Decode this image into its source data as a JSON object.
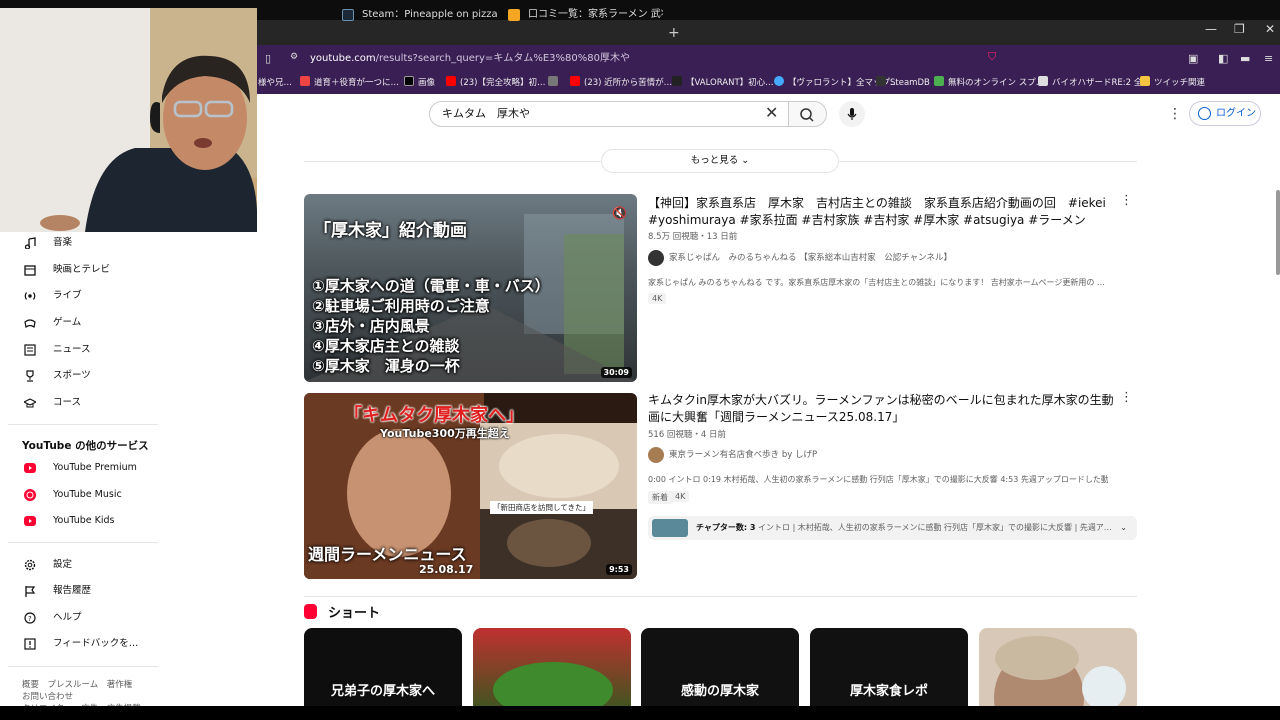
{
  "browser": {
    "tabs": [
      {
        "label": "Steam：Pineapple on pizza",
        "x": 0
      },
      {
        "label": "口コミ一覧：家系ラーメン 武将家 - 秋葉",
        "x": 0
      }
    ],
    "address": {
      "host": "youtube.com",
      "path": "/results?search_query=キムタム%E3%80%80厚木や"
    },
    "bookmarks": [
      "様や兄…",
      "道育＋役育が一つに…",
      "画像",
      "(23)【完全攻略】初…",
      "",
      "(23) 近所から苦情が…",
      "【VALORANT】初心…",
      "【ヴァロラント】全マップ…",
      "SteamDB",
      "無料のオンライン スプ…",
      "バイオハザードRE:2 全…",
      "ツイッチ関連"
    ],
    "win_controls": {
      "min": "—",
      "max": "❐",
      "close": "✕"
    }
  },
  "masthead": {
    "search_value": "キムタム　厚木や",
    "login_label": "ログイン"
  },
  "filters": {
    "more_label": "もっと見る"
  },
  "sidebar": {
    "items": [
      {
        "label": "音楽"
      },
      {
        "label": "映画とテレビ"
      },
      {
        "label": "ライブ"
      },
      {
        "label": "ゲーム"
      },
      {
        "label": "ニュース"
      },
      {
        "label": "スポーツ"
      },
      {
        "label": "コース"
      }
    ],
    "more_services_title": "YouTube の他のサービス",
    "services": [
      {
        "label": "YouTube Premium"
      },
      {
        "label": "YouTube Music"
      },
      {
        "label": "YouTube Kids"
      }
    ],
    "settings": [
      {
        "label": "設定"
      },
      {
        "label": "報告履歴"
      },
      {
        "label": "ヘルプ"
      },
      {
        "label": "フィードバックを…"
      }
    ],
    "footer": [
      "概要　プレスルーム　著作権",
      "お問い合わせ",
      "クリエイター　広告　広告掲載"
    ]
  },
  "results": [
    {
      "title": "【神回】家系直系店　厚木家　吉村店主との雑談　家系直系店紹介動画の回　#iekei #yoshimuraya #家系拉面 #吉村家族 #吉村家 #厚木家 #atsugiya #ラーメン",
      "meta": "8.5万 回視聴・13 日前",
      "channel": "家系じゃぱん　みのるちゃんねる 【家系総本山吉村家　公認チャンネル】",
      "desc": "家系じゃぱん みのるちゃんねる です。家系直系店厚木家の「吉村店主との雑談」になります！ 吉村家ホームページ更新用の …",
      "badges": [
        "4K"
      ],
      "duration": "30:09",
      "thumb_heading": "「厚木家」紹介動画",
      "thumb_lines": [
        "①厚木家への道（電車・車・バス）",
        "②駐車場ご利用時のご注意",
        "③店外・店内風景",
        "④厚木家店主との雑談",
        "⑤厚木家　渾身の一杯"
      ]
    },
    {
      "title": "キムタクin厚木家が大バズリ。ラーメンファンは秘密のベールに包まれた厚木家の生動画に大興奮「週間ラーメンニュース25.08.17」",
      "meta": "516 回視聴・4 日前",
      "channel": "東京ラーメン有名店食べ歩き by しげP",
      "desc": "0:00 イントロ 0:19 木村拓哉、人生初の家系ラーメンに感動 行列店「厚木家」での撮影に大反響 4:53 先週アップロードした動画 …",
      "badges": [
        "新着",
        "4K"
      ],
      "duration": "9:53",
      "chapters_label": "チャプター数: 3",
      "chapters_text": "イントロ | 木村拓哉、人生初の家系ラーメンに感動 行列店「厚木家」での撮影に大反響 | 先週ア…",
      "thumb_heading": "「キムタク厚木家へ」",
      "thumb_sub": "YouTube300万再生超え",
      "thumb_bottom": "週間ラーメンニュース",
      "thumb_date": "25.08.17",
      "thumb_side": "「新田商店を訪問してきた」"
    }
  ],
  "shorts": {
    "title": "ショート",
    "items": [
      "兄弟子の厚木家へ",
      "",
      "感動の厚木家",
      "厚木家食レポ",
      ""
    ]
  },
  "colors": {
    "accent": "#065fd4",
    "brand_red": "#ff0033",
    "addr_purple": "#3a1f55"
  }
}
